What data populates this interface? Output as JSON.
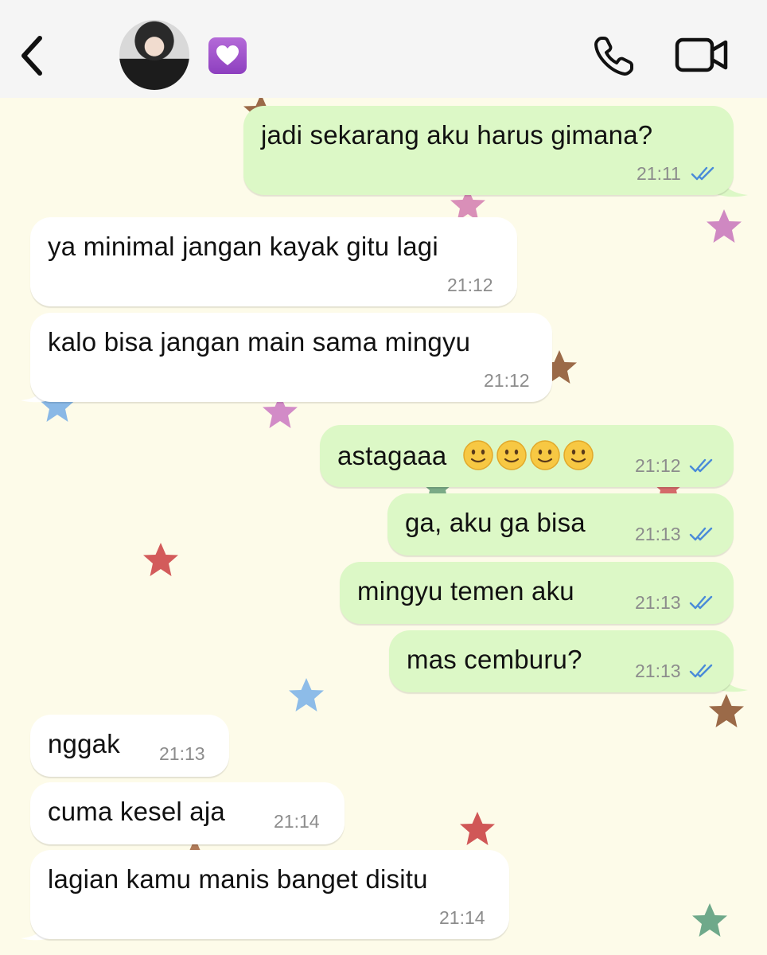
{
  "header": {
    "back_icon": "chevron-left-icon",
    "status_emoji": "purple-heart-emoji",
    "call_icon": "phone-icon",
    "video_icon": "video-camera-icon"
  },
  "colors": {
    "incoming_bubble": "#ffffff",
    "outgoing_bubble": "#dcf8c6",
    "read_ticks": "#4a8bd8",
    "wallpaper": "#fdfbe9"
  },
  "messages": [
    {
      "dir": "out",
      "text": "jadi sekarang aku harus gimana?",
      "time": "21:11",
      "read": true
    },
    {
      "dir": "in",
      "text": "ya minimal jangan kayak gitu lagi",
      "time": "21:12"
    },
    {
      "dir": "in",
      "text": "kalo bisa jangan main sama mingyu",
      "time": "21:12"
    },
    {
      "dir": "out",
      "text": "astagaaa",
      "emoji": "slightly-smiling-face x4",
      "time": "21:12",
      "read": true
    },
    {
      "dir": "out",
      "text": "ga, aku ga bisa",
      "time": "21:13",
      "read": true
    },
    {
      "dir": "out",
      "text": "mingyu temen aku",
      "time": "21:13",
      "read": true
    },
    {
      "dir": "out",
      "text": "mas cemburu?",
      "time": "21:13",
      "read": true
    },
    {
      "dir": "in",
      "text": "nggak",
      "time": "21:13"
    },
    {
      "dir": "in",
      "text": "cuma kesel aja",
      "time": "21:14"
    },
    {
      "dir": "in",
      "text": "lagian kamu manis banget disitu",
      "time": "21:14"
    }
  ]
}
